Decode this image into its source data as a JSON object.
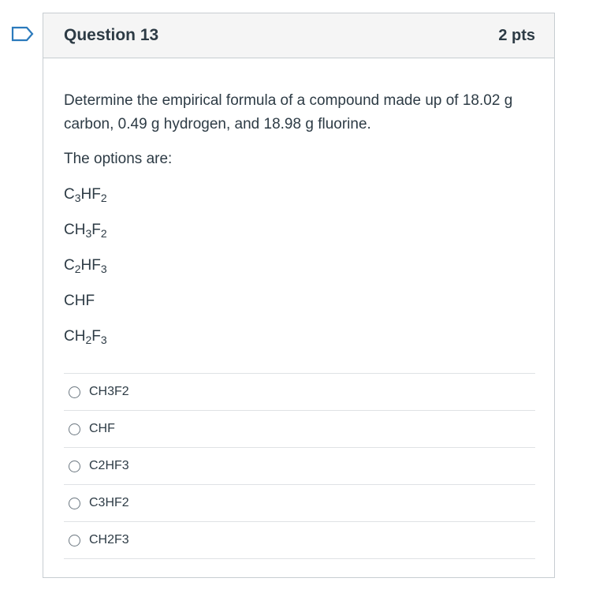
{
  "question": {
    "title": "Question 13",
    "points": "2 pts",
    "prompt": "Determine the empirical formula of a compound made up of 18.02 g carbon, 0.49 g hydrogen, and 18.98 g fluorine.",
    "options_intro": "The options are:",
    "listed_formulas": [
      [
        {
          "t": "C"
        },
        {
          "s": "3"
        },
        {
          "t": "HF"
        },
        {
          "s": "2"
        }
      ],
      [
        {
          "t": "CH"
        },
        {
          "s": "3"
        },
        {
          "t": "F"
        },
        {
          "s": "2"
        }
      ],
      [
        {
          "t": "C"
        },
        {
          "s": "2"
        },
        {
          "t": "HF"
        },
        {
          "s": "3"
        }
      ],
      [
        {
          "t": "CHF"
        }
      ],
      [
        {
          "t": "CH"
        },
        {
          "s": "2"
        },
        {
          "t": "F"
        },
        {
          "s": "3"
        }
      ]
    ],
    "answers": [
      {
        "label": "CH3F2",
        "selected": false
      },
      {
        "label": "CHF",
        "selected": false
      },
      {
        "label": "C2HF3",
        "selected": false
      },
      {
        "label": "C3HF2",
        "selected": false
      },
      {
        "label": "CH2F3",
        "selected": false
      }
    ]
  },
  "colors": {
    "text": "#2d3b45",
    "header_bg": "#f5f5f5",
    "border": "#c7cdd1",
    "flag_outline": "#2b7abc"
  },
  "icons": {
    "flag": "bookmark-flag-icon",
    "radio": "radio-unchecked-icon"
  }
}
